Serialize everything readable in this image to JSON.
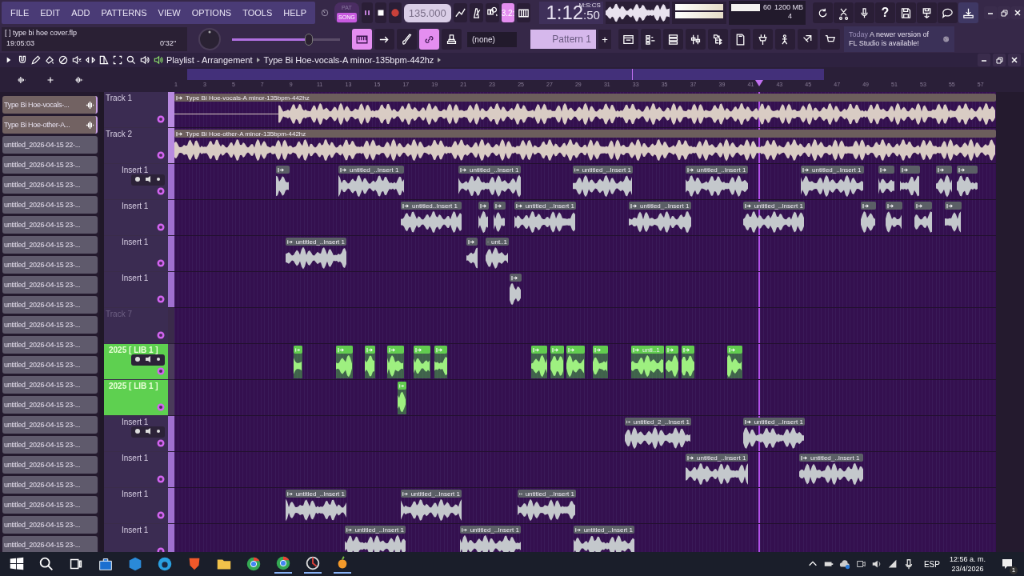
{
  "menu": [
    {
      "label": "FILE"
    },
    {
      "label": "EDIT"
    },
    {
      "label": "ADD"
    },
    {
      "label": "PATTERNS"
    },
    {
      "label": "VIEW"
    },
    {
      "label": "OPTIONS"
    },
    {
      "label": "TOOLS"
    },
    {
      "label": "HELP"
    }
  ],
  "transport": {
    "pat": "PAT",
    "song": "SONG",
    "song_selected": true,
    "recording": false,
    "tempo": "135.000",
    "step": "3.2:"
  },
  "time": {
    "main": "1:12",
    "small": ":50",
    "unit": "M:S:CS"
  },
  "performance": {
    "cpu": "60",
    "memory": "1200 MB",
    "polyphony": "4"
  },
  "help_glyph": "?",
  "project": {
    "bracket": "[  ]",
    "file": "type bi hoe cover.flp",
    "elapsed": "19:05:03",
    "length": "0'32''"
  },
  "master_volume": {
    "level": 0.71
  },
  "channel": "(none)",
  "pattern": {
    "name": "Pattern 1",
    "add": "+"
  },
  "news": {
    "day": "Today",
    "message": "A newer version of FL Studio is available!"
  },
  "playlist": {
    "title": "Playlist - Arrangement",
    "clip": "Type Bi Hoe-vocals-A minor-135bpm-442hz"
  },
  "ruler": [
    "1",
    "3",
    "5",
    "7",
    "9",
    "11",
    "13",
    "15",
    "17",
    "19",
    "21",
    "23",
    "25",
    "27",
    "29",
    "31",
    "33",
    "35",
    "37",
    "39",
    "41",
    "43",
    "45",
    "47",
    "49",
    "51",
    "53",
    "55",
    "57"
  ],
  "picker": [
    {
      "label": "Type Bi Hoe-vocals-...",
      "kind": "audio"
    },
    {
      "label": "Type Bi Hoe-other-A...",
      "kind": "audio"
    },
    {
      "label": "untitled_2026-04-15 22-...",
      "kind": "clip"
    },
    {
      "label": "untitled_2026-04-15 23-...",
      "kind": "clip"
    },
    {
      "label": "untitled_2026-04-15 23-...",
      "kind": "clip"
    },
    {
      "label": "untitled_2026-04-15 23-...",
      "kind": "clip"
    },
    {
      "label": "untitled_2026-04-15 23-...",
      "kind": "clip"
    },
    {
      "label": "untitled_2026-04-15 23-...",
      "kind": "clip"
    },
    {
      "label": "untitled_2026-04-15 23-...",
      "kind": "clip"
    },
    {
      "label": "untitled_2026-04-15 23-...",
      "kind": "clip"
    },
    {
      "label": "untitled_2026-04-15 23-...",
      "kind": "clip"
    },
    {
      "label": "untitled_2026-04-15 23-...",
      "kind": "clip"
    },
    {
      "label": "untitled_2026-04-15 23-...",
      "kind": "clip"
    },
    {
      "label": "untitled_2026-04-15 23-...",
      "kind": "clip"
    },
    {
      "label": "untitled_2026-04-15 23-...",
      "kind": "clip"
    },
    {
      "label": "untitled_2026-04-15 23-...",
      "kind": "clip"
    },
    {
      "label": "untitled_2026-04-15 23-...",
      "kind": "clip"
    },
    {
      "label": "untitled_2026-04-15 23-...",
      "kind": "clip"
    },
    {
      "label": "untitled_2026-04-15 23-...",
      "kind": "clip"
    },
    {
      "label": "untitled_2026-04-15 23-...",
      "kind": "clip"
    },
    {
      "label": "untitled_2026-04-15 23-...",
      "kind": "clip"
    },
    {
      "label": "untitled_2026-04-15 23-...",
      "kind": "clip"
    },
    {
      "label": "untitled_2026-04-15 23-...",
      "kind": "clip"
    }
  ],
  "tracks": [
    {
      "name": "Track 1",
      "kind": "audio",
      "controls": false,
      "clips": [
        {
          "kind": "named",
          "label": "Type Bi Hoe-vocals-A minor-135bpm-442hz"
        }
      ]
    },
    {
      "name": "Track 2",
      "kind": "audio",
      "controls": false,
      "clips": [
        {
          "kind": "named",
          "label": "Type Bi Hoe-other-A minor-135bpm-442hz"
        }
      ]
    },
    {
      "name": "Insert 1",
      "kind": "insert",
      "controls": true,
      "clips": [
        {
          "kind": "short"
        },
        {
          "kind": "named",
          "label": "untitled_..Insert 1"
        },
        {
          "kind": "named",
          "label": "untitled_..Insert 1"
        },
        {
          "kind": "named",
          "label": "untitled_..Insert 1"
        },
        {
          "kind": "named",
          "label": "untitled_..Insert 1"
        },
        {
          "kind": "named",
          "label": "untitled_..Insert 1"
        },
        {
          "kind": "short"
        },
        {
          "kind": "short"
        },
        {
          "kind": "short"
        },
        {
          "kind": "short"
        }
      ]
    },
    {
      "name": "Insert 1",
      "kind": "insert",
      "controls": false,
      "clips": [
        {
          "kind": "named",
          "label": "untitled..Insert 1"
        },
        {
          "kind": "short"
        },
        {
          "kind": "short"
        },
        {
          "kind": "named",
          "label": "untitled_..Insert 1"
        },
        {
          "kind": "named",
          "label": "untitled_..Insert 1"
        },
        {
          "kind": "named",
          "label": "untitled_..Insert 1"
        },
        {
          "kind": "short"
        },
        {
          "kind": "short"
        },
        {
          "kind": "short"
        },
        {
          "kind": "short"
        }
      ]
    },
    {
      "name": "Insert 1",
      "kind": "insert",
      "controls": false,
      "clips": [
        {
          "kind": "named",
          "label": "untitled_..Insert 1"
        },
        {
          "kind": "short"
        },
        {
          "kind": "named",
          "label": "unt..1"
        }
      ]
    },
    {
      "name": "Insert 1",
      "kind": "insert",
      "controls": false,
      "clips": [
        {
          "kind": "short"
        }
      ]
    },
    {
      "name": "Track 7",
      "kind": "empty",
      "controls": false
    },
    {
      "name": "2025 [ LIB 1 ]",
      "kind": "lib",
      "controls": true,
      "clips": [
        {
          "kind": "short"
        },
        {
          "kind": "short"
        },
        {
          "kind": "short"
        },
        {
          "kind": "short"
        },
        {
          "kind": "short"
        },
        {
          "kind": "short"
        },
        {
          "kind": "short"
        },
        {
          "kind": "short"
        },
        {
          "kind": "short"
        },
        {
          "kind": "short"
        },
        {
          "kind": "named",
          "label": "unti..1"
        },
        {
          "kind": "short"
        },
        {
          "kind": "short"
        },
        {
          "kind": "short"
        }
      ]
    },
    {
      "name": "2025 [ LIB 1 ]",
      "kind": "lib",
      "controls": false,
      "clips": [
        {
          "kind": "short"
        }
      ]
    },
    {
      "name": "Insert 1",
      "kind": "insert",
      "controls": true,
      "clips": [
        {
          "kind": "named",
          "label": "untitled_2_..Insert 1"
        },
        {
          "kind": "named",
          "label": "untitled_..Insert 1"
        }
      ]
    },
    {
      "name": "Insert 1",
      "kind": "insert",
      "controls": false,
      "clips": [
        {
          "kind": "named",
          "label": "untitled_..Insert 1"
        },
        {
          "kind": "named",
          "label": "untitled_..Insert 1"
        }
      ]
    },
    {
      "name": "Insert 1",
      "kind": "insert",
      "controls": false,
      "clips": [
        {
          "kind": "named",
          "label": "untitled_..Insert 1"
        },
        {
          "kind": "named",
          "label": "untitled_..Insert 1"
        },
        {
          "kind": "named",
          "label": "untitled_..Insert 1"
        }
      ]
    },
    {
      "name": "Insert 1",
      "kind": "insert",
      "controls": false,
      "clips": [
        {
          "kind": "named",
          "label": "untitled_..Insert 1"
        },
        {
          "kind": "named",
          "label": "untitled_..Insert 1"
        },
        {
          "kind": "named",
          "label": "untitled_..Insert 1"
        }
      ]
    }
  ],
  "tray": {
    "language": "ESP",
    "time": "12:56 a. m.",
    "date": "23/4/2026",
    "notifications": "1"
  }
}
